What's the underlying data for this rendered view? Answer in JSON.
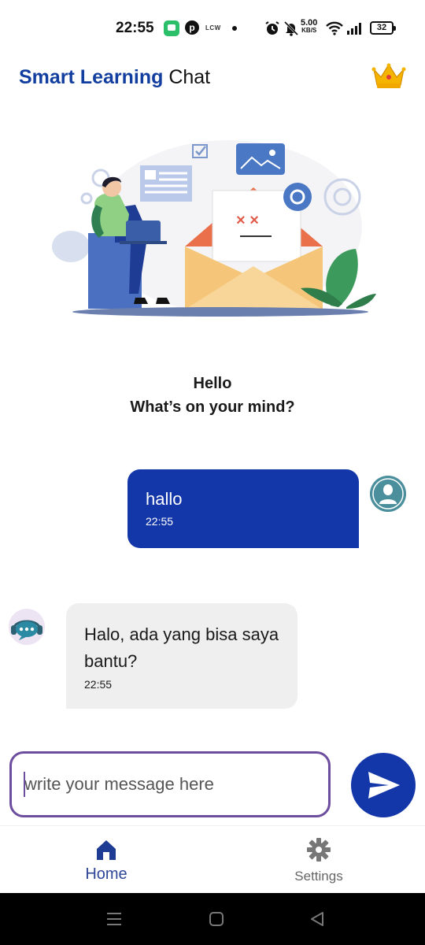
{
  "status_bar": {
    "time": "22:55",
    "lcw_label": "LCW",
    "speed_value": "5.00",
    "speed_unit": "KB/S",
    "battery": "32"
  },
  "header": {
    "title_brand": "Smart Learning",
    "title_rest": " Chat",
    "premium_icon": "crown-icon"
  },
  "greeting": {
    "line1": "Hello",
    "line2": "What’s on your mind?"
  },
  "messages": [
    {
      "sender": "user",
      "text": "hallo",
      "time": "22:55"
    },
    {
      "sender": "bot",
      "text": "Halo, ada yang bisa saya bantu?",
      "time": "22:55"
    }
  ],
  "composer": {
    "placeholder": "write your message here",
    "send_icon": "send-icon"
  },
  "bottom_nav": {
    "items": [
      {
        "label": "Home",
        "icon": "home-icon",
        "active": true
      },
      {
        "label": "Settings",
        "icon": "gear-icon",
        "active": false
      }
    ]
  },
  "colors": {
    "brand": "#123e9f",
    "user_bubble": "#1337a8",
    "bot_bubble": "#efefef",
    "input_border": "#6d4e9e"
  }
}
